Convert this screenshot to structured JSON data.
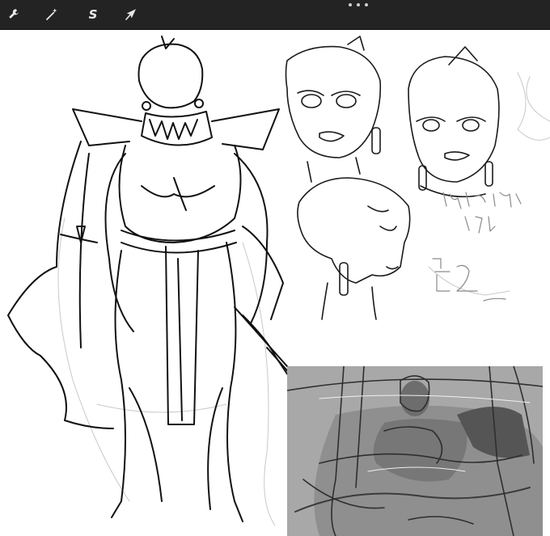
{
  "app": {
    "toolbar": {
      "tools": [
        {
          "id": "adjust",
          "icon": "wrench-icon"
        },
        {
          "id": "wand",
          "icon": "magic-wand-icon"
        },
        {
          "id": "selection",
          "icon": "selection-s-icon",
          "glyph": "S"
        },
        {
          "id": "transform",
          "icon": "arrow-cursor-icon"
        }
      ],
      "more_icon": "more-dots-icon"
    }
  },
  "colors": {
    "toolbar_bg": "#232323",
    "canvas_bg": "#ffffff",
    "ink": "#111111",
    "sketch_gray": "#9a9a9a",
    "ref_panel": "#a9a9a9"
  },
  "canvas": {
    "annotations": {
      "korean_note_1": "디어마ㅡ 신대방",
      "korean_note_2": "ㄱㅓㅅ",
      "korean_note_3": "ㅍ2"
    }
  }
}
